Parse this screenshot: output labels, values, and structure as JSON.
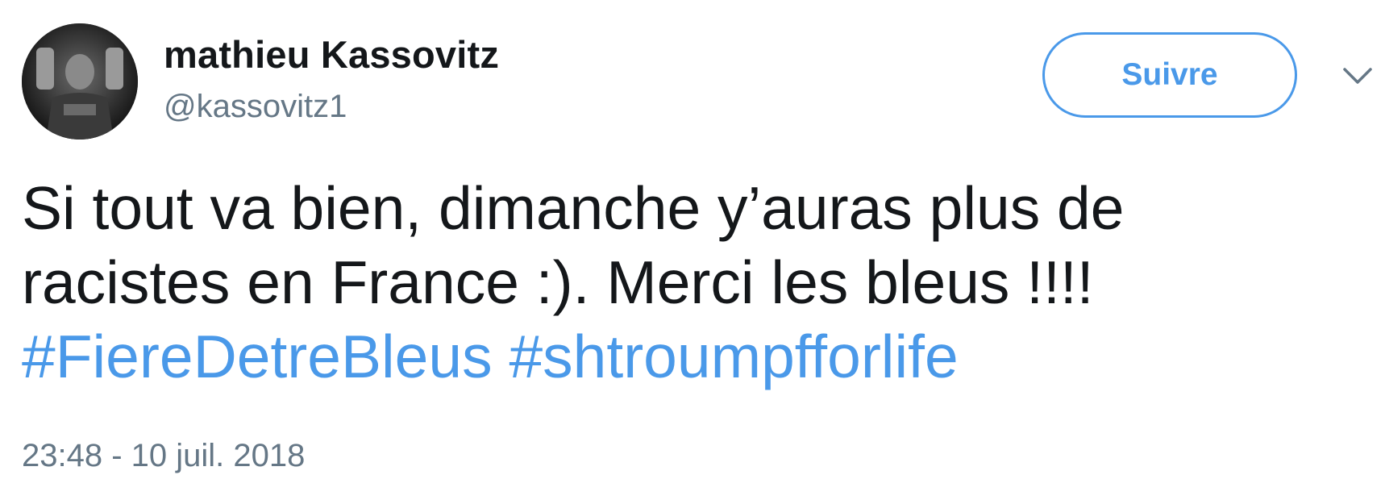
{
  "author": {
    "display_name": "mathieu Kassovitz",
    "handle": "@kassovitz1",
    "avatar_icon": "profile-photo"
  },
  "follow_button": {
    "label": "Suivre",
    "color": "#4a99e9"
  },
  "menu": {
    "icon": "chevron-down-icon"
  },
  "tweet": {
    "line1": "Si tout va bien, dimanche y’auras plus de",
    "line2": "racistes en France :). Merci les bleus !!!!",
    "hashtags": [
      "#FiereDetreBleus",
      "#shtroumpfforlife"
    ],
    "timestamp": "23:48 - 10 juil. 2018"
  },
  "colors": {
    "text": "#14171a",
    "secondary": "#657786",
    "link": "#4a99e9"
  }
}
